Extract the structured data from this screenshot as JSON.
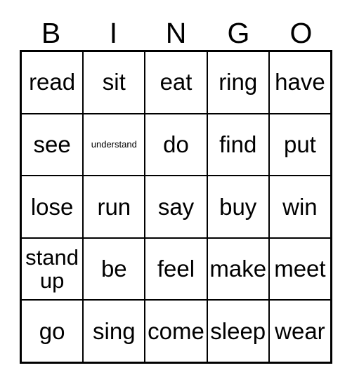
{
  "card": {
    "title": "BINGO",
    "columns": [
      "B",
      "I",
      "N",
      "G",
      "O"
    ],
    "ink_color": "#000000",
    "paper_color": "#ffffff",
    "rows": [
      [
        {
          "text": "read",
          "size": "normal"
        },
        {
          "text": "sit",
          "size": "normal"
        },
        {
          "text": "eat",
          "size": "normal"
        },
        {
          "text": "ring",
          "size": "normal"
        },
        {
          "text": "have",
          "size": "normal"
        }
      ],
      [
        {
          "text": "see",
          "size": "normal"
        },
        {
          "text": "understand",
          "size": "small"
        },
        {
          "text": "do",
          "size": "normal"
        },
        {
          "text": "find",
          "size": "normal"
        },
        {
          "text": "put",
          "size": "normal"
        }
      ],
      [
        {
          "text": "lose",
          "size": "normal"
        },
        {
          "text": "run",
          "size": "normal"
        },
        {
          "text": "say",
          "size": "normal"
        },
        {
          "text": "buy",
          "size": "normal"
        },
        {
          "text": "win",
          "size": "normal"
        }
      ],
      [
        {
          "text": "stand\nup",
          "size": "wrap"
        },
        {
          "text": "be",
          "size": "normal"
        },
        {
          "text": "feel",
          "size": "normal"
        },
        {
          "text": "make",
          "size": "normal"
        },
        {
          "text": "meet",
          "size": "normal"
        }
      ],
      [
        {
          "text": "go",
          "size": "normal"
        },
        {
          "text": "sing",
          "size": "normal"
        },
        {
          "text": "come",
          "size": "normal"
        },
        {
          "text": "sleep",
          "size": "normal"
        },
        {
          "text": "wear",
          "size": "normal"
        }
      ]
    ]
  }
}
